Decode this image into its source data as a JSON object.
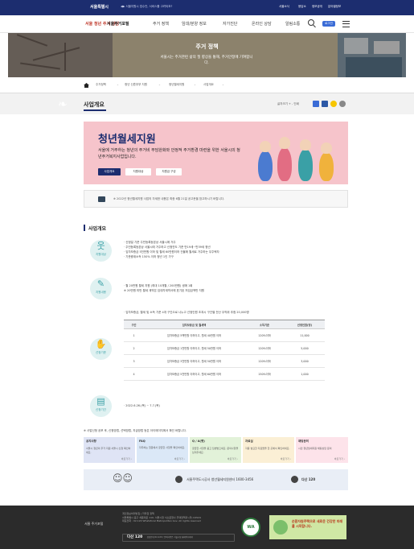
{
  "topbar": {
    "logo": "서울특별시",
    "notice": "◀▶ 서울지원시 접수안, 서비스를 고려되죠?",
    "util": [
      "서울소식",
      "응답소",
      "정보공개",
      "분야별정보"
    ]
  },
  "gnb": {
    "brand": "서울 청년 주거 상담",
    "site": "서울주거포털",
    "menu": [
      "주거 정책",
      "임대/분양 정보",
      "자가진단",
      "온라인 상담",
      "알림소통"
    ],
    "chip": "로그인",
    "colors": {
      "navy": "#1c2d6f",
      "accent": "#3b6cd6"
    }
  },
  "hero": {
    "title": "주거 정책",
    "subtitle": "서울시는 주거관련 삶의 질 향상을 통해, 주거안정에 기여합니다."
  },
  "breadcrumb": [
    "주거정책",
    "청년 신혼부부 지원",
    "청년월세지원",
    "사업개요"
  ],
  "section": {
    "title": "사업개요",
    "tools_label": "글자크기 + - 인쇄"
  },
  "banner": {
    "title": "청년월세지원",
    "desc": "서울에 거주하는 청년의 주거비 부담완화와 안정적 주거환경 마련을 위한 서울시의 청년주거복지사업입니다.",
    "pills": [
      "사업개요",
      "지원대상",
      "지원금 구성"
    ],
    "colors": {
      "bg": "#f6c4cb"
    }
  },
  "notice_box": {
    "text": "※ 2022년 청년월세지원 사업의 자세한 내용은 최종 6월 21일 공고문을 참고하시기 바랍니다."
  },
  "overview": {
    "heading": "사업개요",
    "rows": [
      {
        "icon": "person-icon",
        "caption": "지원대상",
        "items": [
          "· 신청일 기준 주민등록등본상 서울시에 거주",
          "· 주민등록등본상 서울시에 거주하고 신청연도 기준 만19세~만39세 청년",
          "· 임차보증금 5천만원 이하 및 월세 60만원이하 건물에 월세로 거주하는 무주택자",
          "· 기준중위소득 150% 이하 청년 1인 가구"
        ]
      },
      {
        "icon": "edit-icon",
        "caption": "지원내용",
        "items": [
          "· 월 20만원 월세 지원 (최대 10개월 / 200만원) 생애 1회",
          "   ※ 20만원 미만 월세 계약은 임대차계약서에 표기된 처임금액만 지원"
        ]
      },
      {
        "icon": "hand-coin-icon",
        "caption": "선정기준",
        "items": [
          "· 임차보증금, 월세 및 소득 기준 4개 구간으로 나누고 선정인원 초과시 구간별 전산 무작위 추첨 20,000명"
        ]
      },
      {
        "icon": "calendar-icon",
        "caption": "신청기간",
        "items": [
          "· 2022.6.26.(목) ~ 7.7.(목)"
        ]
      }
    ],
    "table": {
      "headers": [
        "구간",
        "임차보증금 및 월세액",
        "소득기준",
        "선정인원(명)"
      ],
      "rows": [
        [
          "1",
          "임차보증금 5백만원 이하이고, 월세 40만원 이하",
          "120%이하",
          "11,000"
        ],
        [
          "2",
          "임차보증금 1천만원 이하이고, 월세 50만원 이하",
          "120%이하",
          "5,000"
        ],
        [
          "3",
          "임차보증금 3천만원 이하이고, 월세 50만원 이하",
          "120%이하",
          "3,000"
        ],
        [
          "4",
          "임차보증금 5천만원 이하이고, 월세 60만원 이하",
          "150%이하",
          "1,000"
        ]
      ]
    }
  },
  "tips": {
    "intro": "※ 사업신청 공포 후, 신청방법, 선택방법, 지급방법 등은 아이에이지에서 확인 바랍니다.",
    "cards": [
      {
        "title": "공지사항",
        "body": "서울시 청년의 주거 지원 서울시 신청 확인하세요.",
        "more": "바로가기 ›",
        "color": "#dfe4f5"
      },
      {
        "title": "FAQ",
        "body": "자주하는 질문에서 궁금한 사항을 확인하세요.",
        "more": "바로가기 ›",
        "color": "#dbe8f7"
      },
      {
        "title": "Q / A(뱃)",
        "body": "궁금한 사항을 묻고 답변받으세요. 문의사항을 남겨주세요.",
        "more": "바로가기 ›",
        "color": "#e2f2d9"
      },
      {
        "title": "자료실",
        "body": "각종 필요한 자료들을 한 곳에서 확인하세요.",
        "more": "바로가기 ›",
        "color": "#fbefd5"
      },
      {
        "title": "채팅문의",
        "body": "시민 청년월세지원 채팅상담 문의",
        "more": "바로가기 ›",
        "color": "#fde3ea"
      }
    ]
  },
  "contact": {
    "text": "서울주택도시공사 청년월세지원센터 1600-3456",
    "dasan": "다산 120"
  },
  "footer": {
    "logo": "서울 주거포털",
    "lines": [
      "개인정보처리방침 | 저작권 정책",
      "서울특별시 중구 세종대로 110, 서울시청 서소문청사 주택정책과 (우) 04524",
      "대표전화 : 02-120 Whatsforal Metropolitan Gov. All rights reserved"
    ],
    "hotline": "다산 120",
    "hotline_note": "상담안내 02-120 / 문의사항은 서울시청 홈페이지에서",
    "badge": "WA",
    "ad_text": "순환자원주택으로 새로운 건강한 미래를 시작합니다."
  }
}
